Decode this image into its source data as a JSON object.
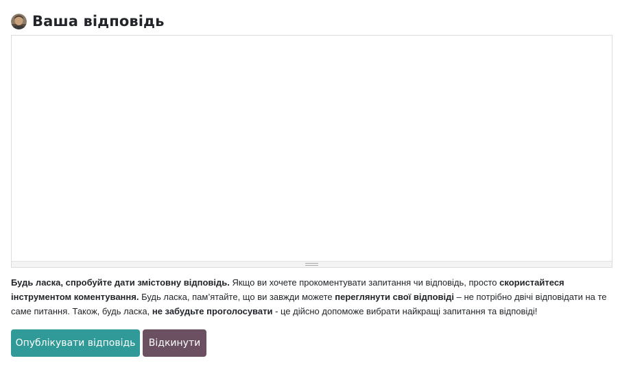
{
  "answer_form": {
    "heading": "Ваша відповідь",
    "editor": {
      "value": "",
      "placeholder": ""
    },
    "notice": {
      "s1_bold": "Будь ласка, спробуйте дати змістовну відповідь.",
      "s1_rest": " Якщо ви хочете прокоментувати запитання чи відповідь, просто ",
      "s2_bold": "скористайтеся інструментом коментування.",
      "s2_rest": " Будь ласка, пам’ятайте, що ви завжди можете ",
      "s3_bold": "переглянути свої відповіді",
      "s3_rest": " – не потрібно двічі відповідати на те саме питання. Також, будь ласка, ",
      "s4_bold": "не забудьте проголосувати",
      "s4_rest": " - це дійсно допоможе вибрати найкращі запитання та відповіді!"
    },
    "buttons": {
      "post_label": "Опублікувати відповідь",
      "discard_label": "Відкинути"
    },
    "colors": {
      "post_button": "#2f9a97",
      "discard_button": "#6a5060"
    }
  }
}
